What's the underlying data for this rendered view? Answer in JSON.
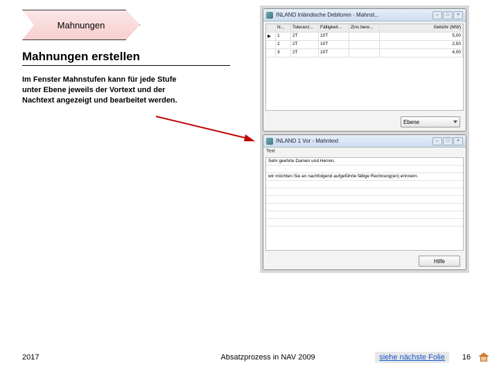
{
  "chevron": {
    "label": "Mahnungen"
  },
  "heading": "Mahnungen erstellen",
  "body": "Im Fenster Mahnstufen kann für jede Stufe unter Ebene jeweils der Vortext und der Nachtext angezeigt und bearbeitet werden.",
  "screenshots": {
    "win1": {
      "title": "INLAND Inländische Debitoren - Mahnst...",
      "columns": [
        "",
        "N...",
        "Toleranz...",
        "Fälligkeit...",
        "Zins bere...",
        "Gebühr (MW)"
      ],
      "rows": [
        [
          "▶",
          "1",
          "2T",
          "10T",
          "",
          "5,00"
        ],
        [
          "",
          "2",
          "2T",
          "10T",
          "",
          "2,50"
        ],
        [
          "",
          "3",
          "2T",
          "10T",
          "",
          "4,00"
        ]
      ],
      "combo_label": "Ebene"
    },
    "win2": {
      "title": "INLAND 1 Vor - Mahntext",
      "field_label": "Text",
      "lines": [
        "Sehr geehrte Damen und Herren,",
        "",
        "wir möchten Sie an nachfolgend aufgeführte fällige Rechnung(en) erinnern."
      ],
      "button": "Hilfe"
    }
  },
  "footer": {
    "year": "2017",
    "mid": "Absatzprozess in NAV 2009",
    "next": "siehe  nächste Folie",
    "page": "16"
  },
  "window_controls": {
    "min": "–",
    "max": "□",
    "close": "×"
  }
}
